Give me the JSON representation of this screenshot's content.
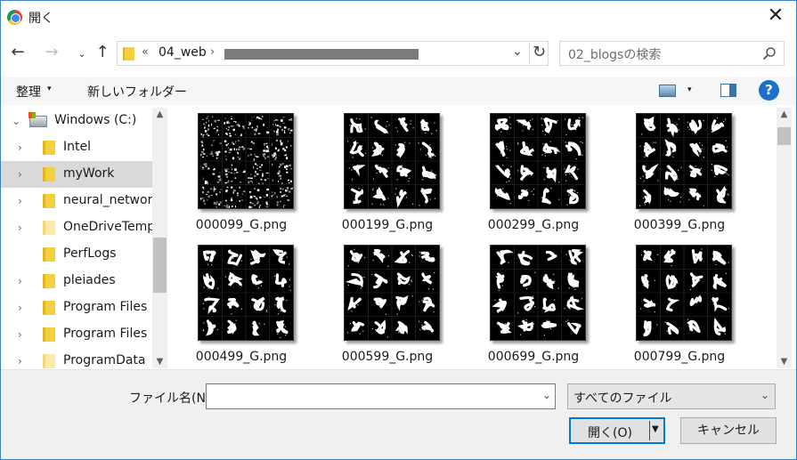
{
  "title_bar": {
    "title": "開く",
    "close_glyph": "✕"
  },
  "nav": {
    "back_glyph": "←",
    "forward_glyph": "→",
    "recent_glyph": "⌄",
    "up_glyph": "↑"
  },
  "address": {
    "overflow_glyph": "«",
    "segment": "04_web",
    "separator_glyph": "›",
    "dropdown_glyph": "⌄",
    "refresh_glyph": "↻"
  },
  "search": {
    "placeholder": "02_blogsの検索"
  },
  "toolbar": {
    "organize_label": "整理",
    "dropdown_glyph": "▾",
    "new_folder_label": "新しいフォルダー",
    "help_label": "?"
  },
  "tree": {
    "chevron_glyph": "›",
    "items": [
      {
        "label": "Windows (C:)",
        "type": "drive",
        "expander": "⌄",
        "selected": false
      },
      {
        "label": "Intel",
        "type": "folder",
        "expander": "›",
        "selected": false
      },
      {
        "label": "myWork",
        "type": "folder",
        "expander": "›",
        "selected": true
      },
      {
        "label": "neural_network",
        "type": "folder",
        "expander": "›",
        "selected": false
      },
      {
        "label": "OneDriveTemp",
        "type": "folder-pale",
        "expander": "›",
        "selected": false
      },
      {
        "label": "PerfLogs",
        "type": "folder",
        "expander": "",
        "selected": false
      },
      {
        "label": "pleiades",
        "type": "folder",
        "expander": "›",
        "selected": false
      },
      {
        "label": "Program Files",
        "type": "folder",
        "expander": "›",
        "selected": false
      },
      {
        "label": "Program Files (",
        "type": "folder",
        "expander": "›",
        "selected": false
      },
      {
        "label": "ProgramData",
        "type": "folder-pale",
        "expander": "›",
        "selected": false
      }
    ]
  },
  "files": [
    {
      "name": "000099_G.png",
      "quality": 0.0
    },
    {
      "name": "000199_G.png",
      "quality": 0.55
    },
    {
      "name": "000299_G.png",
      "quality": 0.6
    },
    {
      "name": "000399_G.png",
      "quality": 0.65
    },
    {
      "name": "000499_G.png",
      "quality": 0.7
    },
    {
      "name": "000599_G.png",
      "quality": 0.75
    },
    {
      "name": "000699_G.png",
      "quality": 0.8
    },
    {
      "name": "000799_G.png",
      "quality": 0.85
    }
  ],
  "scroll": {
    "up_glyph": "▲",
    "down_glyph": "▼"
  },
  "bottom": {
    "filename_label": "ファイル名(N):",
    "filename_value": "",
    "filename_dropdown_glyph": "⌄",
    "filetype_value": "すべてのファイル",
    "filetype_dropdown_glyph": "⌄",
    "open_label": "開く(O)",
    "open_dropdown_glyph": "▼",
    "cancel_label": "キャンセル"
  },
  "colors": {
    "accent": "#0078d7",
    "window_border": "#3d80c4",
    "selection": "#d9d9d9"
  }
}
